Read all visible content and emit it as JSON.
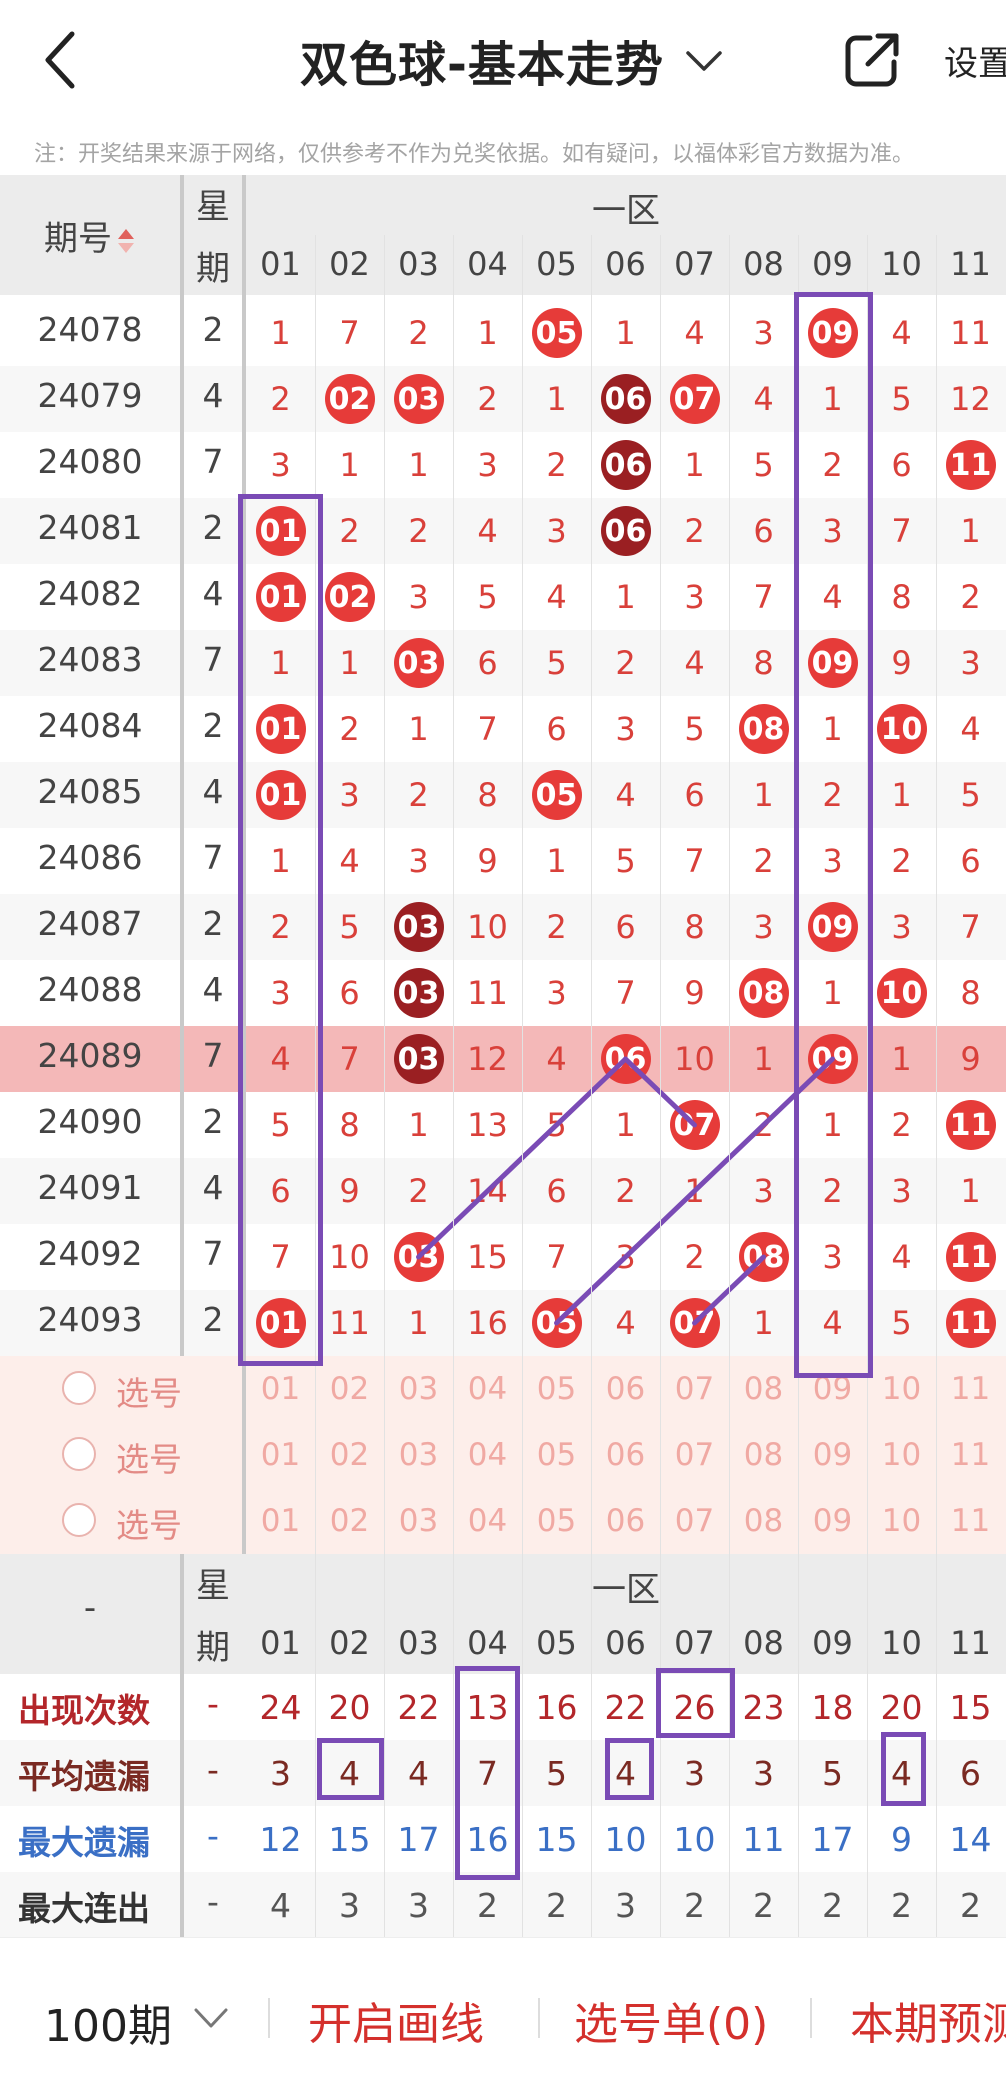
{
  "header": {
    "title": "双色球-基本走势",
    "settings_label": "设置",
    "notice": "注：开奖结果来源于网络，仅供参考不作为兑奖依据。如有疑问，以福体彩官方数据为准。"
  },
  "table": {
    "issue_header": "期号",
    "week_header_top": "星",
    "week_header_bottom": "期",
    "zone_label": "一区",
    "columns": [
      "01",
      "02",
      "03",
      "04",
      "05",
      "06",
      "07",
      "08",
      "09",
      "10",
      "11"
    ],
    "rows": [
      {
        "issue": "24078",
        "week": "2",
        "cells": [
          {
            "v": "1"
          },
          {
            "v": "7"
          },
          {
            "v": "2"
          },
          {
            "v": "1"
          },
          {
            "v": "05",
            "ball": "red"
          },
          {
            "v": "1"
          },
          {
            "v": "4"
          },
          {
            "v": "3"
          },
          {
            "v": "09",
            "ball": "red"
          },
          {
            "v": "4"
          },
          {
            "v": "11"
          }
        ]
      },
      {
        "issue": "24079",
        "week": "4",
        "cells": [
          {
            "v": "2"
          },
          {
            "v": "02",
            "ball": "red"
          },
          {
            "v": "03",
            "ball": "red"
          },
          {
            "v": "2"
          },
          {
            "v": "1"
          },
          {
            "v": "06",
            "ball": "dark"
          },
          {
            "v": "07",
            "ball": "red"
          },
          {
            "v": "4"
          },
          {
            "v": "1"
          },
          {
            "v": "5"
          },
          {
            "v": "12"
          }
        ]
      },
      {
        "issue": "24080",
        "week": "7",
        "cells": [
          {
            "v": "3"
          },
          {
            "v": "1"
          },
          {
            "v": "1"
          },
          {
            "v": "3"
          },
          {
            "v": "2"
          },
          {
            "v": "06",
            "ball": "dark"
          },
          {
            "v": "1"
          },
          {
            "v": "5"
          },
          {
            "v": "2"
          },
          {
            "v": "6"
          },
          {
            "v": "11",
            "ball": "red"
          }
        ]
      },
      {
        "issue": "24081",
        "week": "2",
        "cells": [
          {
            "v": "01",
            "ball": "red"
          },
          {
            "v": "2"
          },
          {
            "v": "2"
          },
          {
            "v": "4"
          },
          {
            "v": "3"
          },
          {
            "v": "06",
            "ball": "dark"
          },
          {
            "v": "2"
          },
          {
            "v": "6"
          },
          {
            "v": "3"
          },
          {
            "v": "7"
          },
          {
            "v": "1"
          }
        ]
      },
      {
        "issue": "24082",
        "week": "4",
        "cells": [
          {
            "v": "01",
            "ball": "red"
          },
          {
            "v": "02",
            "ball": "red"
          },
          {
            "v": "3"
          },
          {
            "v": "5"
          },
          {
            "v": "4"
          },
          {
            "v": "1"
          },
          {
            "v": "3"
          },
          {
            "v": "7"
          },
          {
            "v": "4"
          },
          {
            "v": "8"
          },
          {
            "v": "2"
          }
        ]
      },
      {
        "issue": "24083",
        "week": "7",
        "cells": [
          {
            "v": "1"
          },
          {
            "v": "1"
          },
          {
            "v": "03",
            "ball": "red"
          },
          {
            "v": "6"
          },
          {
            "v": "5"
          },
          {
            "v": "2"
          },
          {
            "v": "4"
          },
          {
            "v": "8"
          },
          {
            "v": "09",
            "ball": "red"
          },
          {
            "v": "9"
          },
          {
            "v": "3"
          }
        ]
      },
      {
        "issue": "24084",
        "week": "2",
        "cells": [
          {
            "v": "01",
            "ball": "red"
          },
          {
            "v": "2"
          },
          {
            "v": "1"
          },
          {
            "v": "7"
          },
          {
            "v": "6"
          },
          {
            "v": "3"
          },
          {
            "v": "5"
          },
          {
            "v": "08",
            "ball": "red"
          },
          {
            "v": "1"
          },
          {
            "v": "10",
            "ball": "red"
          },
          {
            "v": "4"
          }
        ]
      },
      {
        "issue": "24085",
        "week": "4",
        "cells": [
          {
            "v": "01",
            "ball": "red"
          },
          {
            "v": "3"
          },
          {
            "v": "2"
          },
          {
            "v": "8"
          },
          {
            "v": "05",
            "ball": "red"
          },
          {
            "v": "4"
          },
          {
            "v": "6"
          },
          {
            "v": "1"
          },
          {
            "v": "2"
          },
          {
            "v": "1"
          },
          {
            "v": "5"
          }
        ]
      },
      {
        "issue": "24086",
        "week": "7",
        "cells": [
          {
            "v": "1"
          },
          {
            "v": "4"
          },
          {
            "v": "3"
          },
          {
            "v": "9"
          },
          {
            "v": "1"
          },
          {
            "v": "5"
          },
          {
            "v": "7"
          },
          {
            "v": "2"
          },
          {
            "v": "3"
          },
          {
            "v": "2"
          },
          {
            "v": "6"
          }
        ]
      },
      {
        "issue": "24087",
        "week": "2",
        "cells": [
          {
            "v": "2"
          },
          {
            "v": "5"
          },
          {
            "v": "03",
            "ball": "dark"
          },
          {
            "v": "10"
          },
          {
            "v": "2"
          },
          {
            "v": "6"
          },
          {
            "v": "8"
          },
          {
            "v": "3"
          },
          {
            "v": "09",
            "ball": "red"
          },
          {
            "v": "3"
          },
          {
            "v": "7"
          }
        ]
      },
      {
        "issue": "24088",
        "week": "4",
        "cells": [
          {
            "v": "3"
          },
          {
            "v": "6"
          },
          {
            "v": "03",
            "ball": "dark"
          },
          {
            "v": "11"
          },
          {
            "v": "3"
          },
          {
            "v": "7"
          },
          {
            "v": "9"
          },
          {
            "v": "08",
            "ball": "red"
          },
          {
            "v": "1"
          },
          {
            "v": "10",
            "ball": "red"
          },
          {
            "v": "8"
          }
        ]
      },
      {
        "issue": "24089",
        "week": "7",
        "highlight": true,
        "cells": [
          {
            "v": "4"
          },
          {
            "v": "7"
          },
          {
            "v": "03",
            "ball": "dark"
          },
          {
            "v": "12"
          },
          {
            "v": "4"
          },
          {
            "v": "06",
            "ball": "red"
          },
          {
            "v": "10"
          },
          {
            "v": "1"
          },
          {
            "v": "09",
            "ball": "red"
          },
          {
            "v": "1"
          },
          {
            "v": "9"
          }
        ]
      },
      {
        "issue": "24090",
        "week": "2",
        "cells": [
          {
            "v": "5"
          },
          {
            "v": "8"
          },
          {
            "v": "1"
          },
          {
            "v": "13"
          },
          {
            "v": "5"
          },
          {
            "v": "1"
          },
          {
            "v": "07",
            "ball": "red"
          },
          {
            "v": "2"
          },
          {
            "v": "1"
          },
          {
            "v": "2"
          },
          {
            "v": "11",
            "ball": "red"
          }
        ]
      },
      {
        "issue": "24091",
        "week": "4",
        "cells": [
          {
            "v": "6"
          },
          {
            "v": "9"
          },
          {
            "v": "2"
          },
          {
            "v": "14"
          },
          {
            "v": "6"
          },
          {
            "v": "2"
          },
          {
            "v": "1"
          },
          {
            "v": "3"
          },
          {
            "v": "2"
          },
          {
            "v": "3"
          },
          {
            "v": "1"
          }
        ]
      },
      {
        "issue": "24092",
        "week": "7",
        "cells": [
          {
            "v": "7"
          },
          {
            "v": "10"
          },
          {
            "v": "03",
            "ball": "red"
          },
          {
            "v": "15"
          },
          {
            "v": "7"
          },
          {
            "v": "3"
          },
          {
            "v": "2"
          },
          {
            "v": "08",
            "ball": "red"
          },
          {
            "v": "3"
          },
          {
            "v": "4"
          },
          {
            "v": "11",
            "ball": "red"
          }
        ]
      },
      {
        "issue": "24093",
        "week": "2",
        "cells": [
          {
            "v": "01",
            "ball": "red"
          },
          {
            "v": "11"
          },
          {
            "v": "1"
          },
          {
            "v": "16"
          },
          {
            "v": "05",
            "ball": "red"
          },
          {
            "v": "4"
          },
          {
            "v": "07",
            "ball": "red"
          },
          {
            "v": "1"
          },
          {
            "v": "4"
          },
          {
            "v": "5"
          },
          {
            "v": "11",
            "ball": "red"
          }
        ]
      }
    ],
    "pick_rows": [
      {
        "label": "选号"
      },
      {
        "label": "选号"
      },
      {
        "label": "选号"
      }
    ]
  },
  "stats": {
    "first_col_label": "-",
    "week_header_top": "星",
    "week_header_bottom": "期",
    "zone_label": "一区",
    "rows": [
      {
        "label": "出现次数",
        "dash": "-",
        "color": "#b3262a",
        "label_color": "#b3262a",
        "values": [
          "24",
          "20",
          "22",
          "13",
          "16",
          "22",
          "26",
          "23",
          "18",
          "20",
          "15"
        ]
      },
      {
        "label": "平均遗漏",
        "dash": "-",
        "color": "#7a2a22",
        "label_color": "#7a2a22",
        "values": [
          "3",
          "4",
          "4",
          "7",
          "5",
          "4",
          "3",
          "3",
          "5",
          "4",
          "6"
        ]
      },
      {
        "label": "最大遗漏",
        "dash": "-",
        "color": "#3a6fc5",
        "label_color": "#3a6fc5",
        "values": [
          "12",
          "15",
          "17",
          "16",
          "15",
          "10",
          "10",
          "11",
          "17",
          "9",
          "14"
        ]
      },
      {
        "label": "最大连出",
        "dash": "-",
        "color": "#555555",
        "label_color": "#333333",
        "values": [
          "4",
          "3",
          "3",
          "2",
          "2",
          "3",
          "2",
          "2",
          "2",
          "2",
          "2"
        ]
      }
    ]
  },
  "footer": {
    "period_label": "100期",
    "draw_line_label": "开启画线",
    "pick_list_label": "选号单(0)",
    "forecast_label": "本期预测"
  },
  "colors": {
    "accent": "#d4302c",
    "ball_red": "#e63b39",
    "ball_dark": "#9a1f22",
    "annotation": "#7a4bb5"
  }
}
